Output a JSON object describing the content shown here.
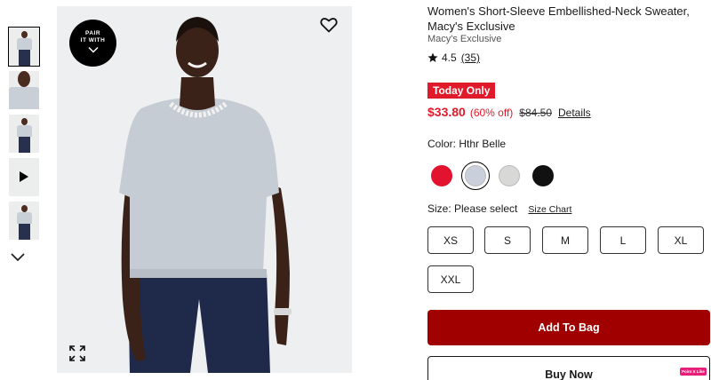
{
  "product": {
    "title": "Women's Short-Sleeve Embellished-Neck Sweater, Macy's Exclusive",
    "brand": "Macy's Exclusive",
    "rating": "4.5",
    "review_count": "(35)"
  },
  "gallery": {
    "pair_badge_line1": "PAIR",
    "pair_badge_line2": "IT WITH",
    "thumbnails": [
      "thumbnail-1",
      "thumbnail-2",
      "thumbnail-3",
      "video-thumbnail",
      "thumbnail-5"
    ],
    "icons": [
      "heart-icon",
      "expand-icon",
      "chevron-down-icon",
      "play-icon"
    ]
  },
  "pricing": {
    "badge": "Today Only",
    "current": "$33.80",
    "discount": "(60% off)",
    "original": "$84.50",
    "details_link": "Details",
    "sale_color": "#e01a2b"
  },
  "color": {
    "label": "Color: Hthr Belle",
    "swatches": [
      {
        "name": "red",
        "hex": "#e3122e"
      },
      {
        "name": "Hthr Belle",
        "hex": "#c9d0dc",
        "selected": true
      },
      {
        "name": "light-gray",
        "hex": "#d8d8d6"
      },
      {
        "name": "black",
        "hex": "#111111"
      }
    ]
  },
  "size": {
    "label": "Size: Please select",
    "chart_link": "Size Chart",
    "options": [
      "XS",
      "S",
      "M",
      "L",
      "XL",
      "XXL"
    ]
  },
  "actions": {
    "add_to_bag": "Add To Bag",
    "buy_now": "Buy Now",
    "add_to_bag_color": "#a10000"
  },
  "point_like_badge": "Point X Like"
}
